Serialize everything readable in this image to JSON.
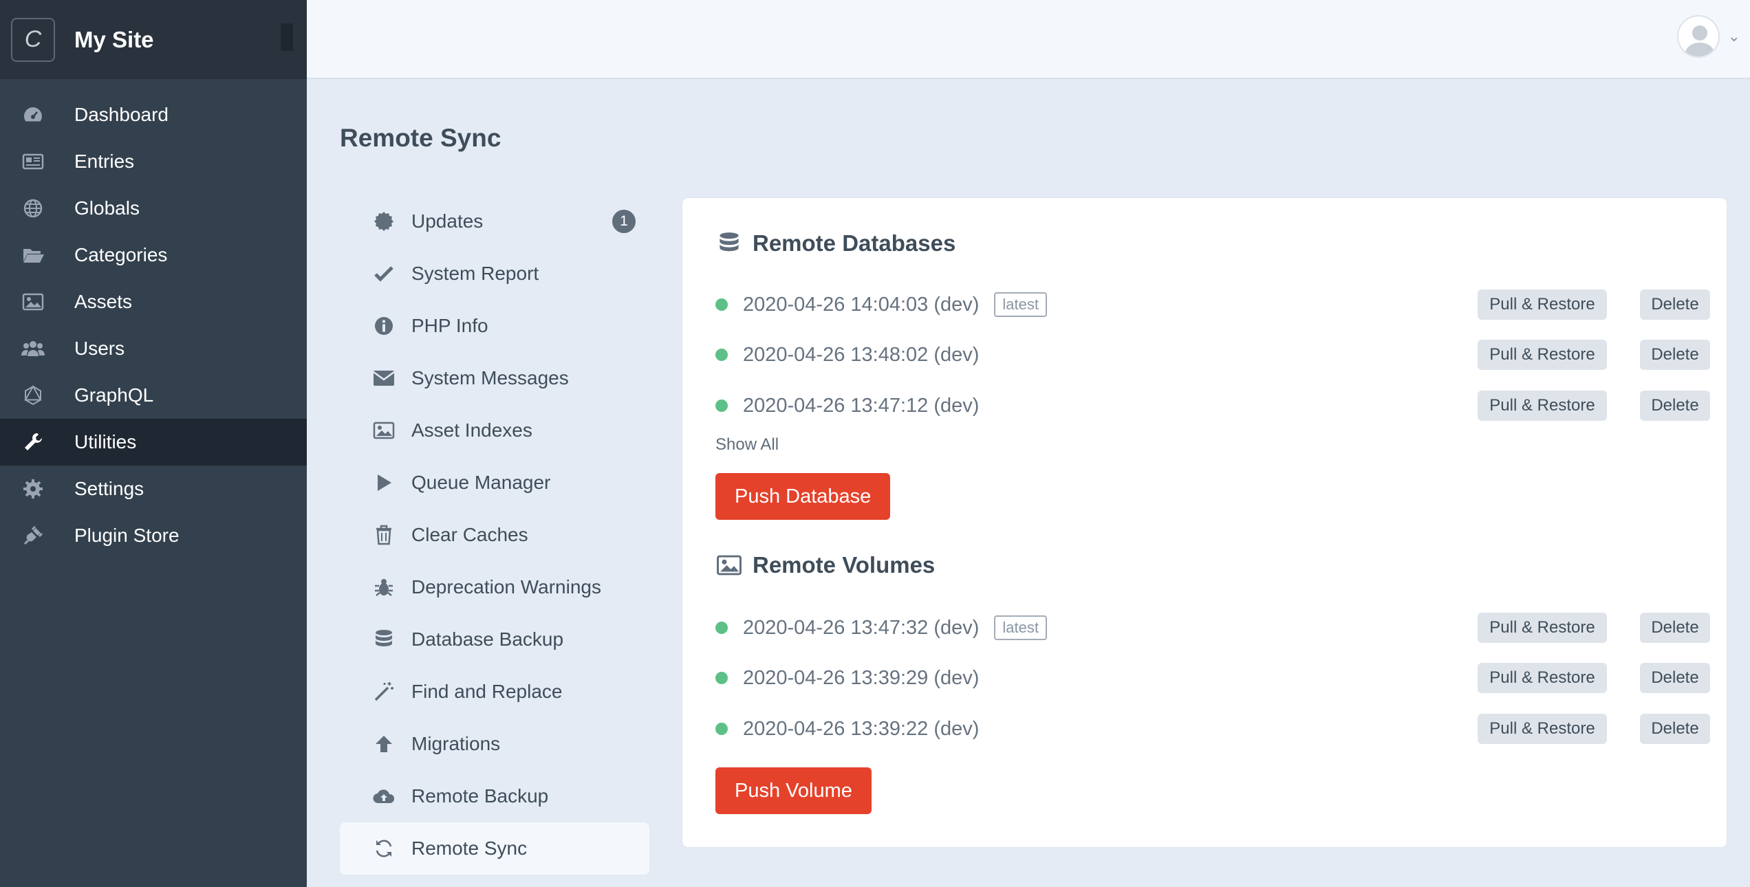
{
  "sidebar": {
    "logo_letter": "C",
    "site_name": "My Site",
    "items": [
      {
        "label": "Dashboard",
        "icon": "gauge-icon"
      },
      {
        "label": "Entries",
        "icon": "newspaper-icon"
      },
      {
        "label": "Globals",
        "icon": "globe-icon"
      },
      {
        "label": "Categories",
        "icon": "folder-open-icon"
      },
      {
        "label": "Assets",
        "icon": "image-icon"
      },
      {
        "label": "Users",
        "icon": "users-icon"
      },
      {
        "label": "GraphQL",
        "icon": "graphql-icon"
      },
      {
        "label": "Utilities",
        "icon": "wrench-icon",
        "active": true
      },
      {
        "label": "Settings",
        "icon": "gear-icon"
      },
      {
        "label": "Plugin Store",
        "icon": "plug-icon"
      }
    ]
  },
  "page": {
    "title": "Remote Sync"
  },
  "subnav": {
    "items": [
      {
        "label": "Updates",
        "icon": "badge-icon",
        "badge": "1"
      },
      {
        "label": "System Report",
        "icon": "check-icon"
      },
      {
        "label": "PHP Info",
        "icon": "info-icon"
      },
      {
        "label": "System Messages",
        "icon": "envelope-icon"
      },
      {
        "label": "Asset Indexes",
        "icon": "image-icon"
      },
      {
        "label": "Queue Manager",
        "icon": "play-icon"
      },
      {
        "label": "Clear Caches",
        "icon": "trash-icon"
      },
      {
        "label": "Deprecation Warnings",
        "icon": "bug-icon"
      },
      {
        "label": "Database Backup",
        "icon": "database-icon"
      },
      {
        "label": "Find and Replace",
        "icon": "magic-wand-icon"
      },
      {
        "label": "Migrations",
        "icon": "arrow-up-icon"
      },
      {
        "label": "Remote Backup",
        "icon": "cloud-upload-icon"
      },
      {
        "label": "Remote Sync",
        "icon": "sync-icon",
        "active": true
      }
    ]
  },
  "databases": {
    "title": "Remote Databases",
    "rows": [
      {
        "label": "2020-04-26 14:04:03 (dev)",
        "tag": "latest"
      },
      {
        "label": "2020-04-26 13:48:02 (dev)"
      },
      {
        "label": "2020-04-26 13:47:12 (dev)"
      }
    ],
    "show_all": "Show All",
    "push_label": "Push Database"
  },
  "volumes": {
    "title": "Remote Volumes",
    "rows": [
      {
        "label": "2020-04-26 13:47:32 (dev)",
        "tag": "latest"
      },
      {
        "label": "2020-04-26 13:39:29 (dev)"
      },
      {
        "label": "2020-04-26 13:39:22 (dev)"
      }
    ],
    "push_label": "Push Volume"
  },
  "row_actions": {
    "pull": "Pull & Restore",
    "delete": "Delete"
  },
  "colors": {
    "accent_red": "#e5422b",
    "status_green": "#27ab5f",
    "sidebar_bg": "#33404d"
  }
}
